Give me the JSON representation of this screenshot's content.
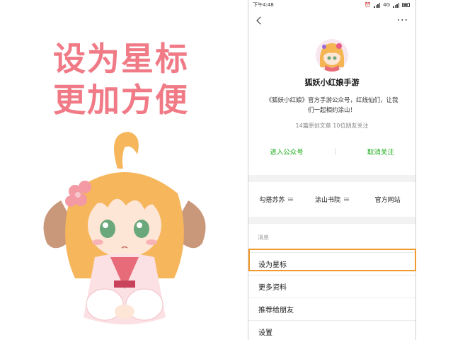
{
  "promo": {
    "line1": "设为星标",
    "line2": "更加方便",
    "text_color": "#f07a86"
  },
  "status_bar": {
    "time": "下午4:48",
    "network": "4G"
  },
  "navbar": {
    "back_icon": "chevron-left",
    "more_icon": "ellipsis"
  },
  "profile": {
    "name": "狐妖小红娘手游",
    "description": "《狐妖小红娘》官方手游公众号，红线仙们，让我们一起相约涂山！",
    "stats": "14篇原创文章  10位朋友关注"
  },
  "actions": {
    "enter": "进入公众号",
    "unfollow": "取消关注",
    "link_color": "#1aad19"
  },
  "menu": [
    {
      "label": "勾搭苏苏"
    },
    {
      "label": "涂山书院"
    },
    {
      "label": "官方网站"
    }
  ],
  "section_label": "消息",
  "list": [
    {
      "label": "设为星标"
    },
    {
      "label": "更多资料"
    },
    {
      "label": "推荐给朋友"
    },
    {
      "label": "设置"
    }
  ],
  "highlight_color": "#f39a2f"
}
